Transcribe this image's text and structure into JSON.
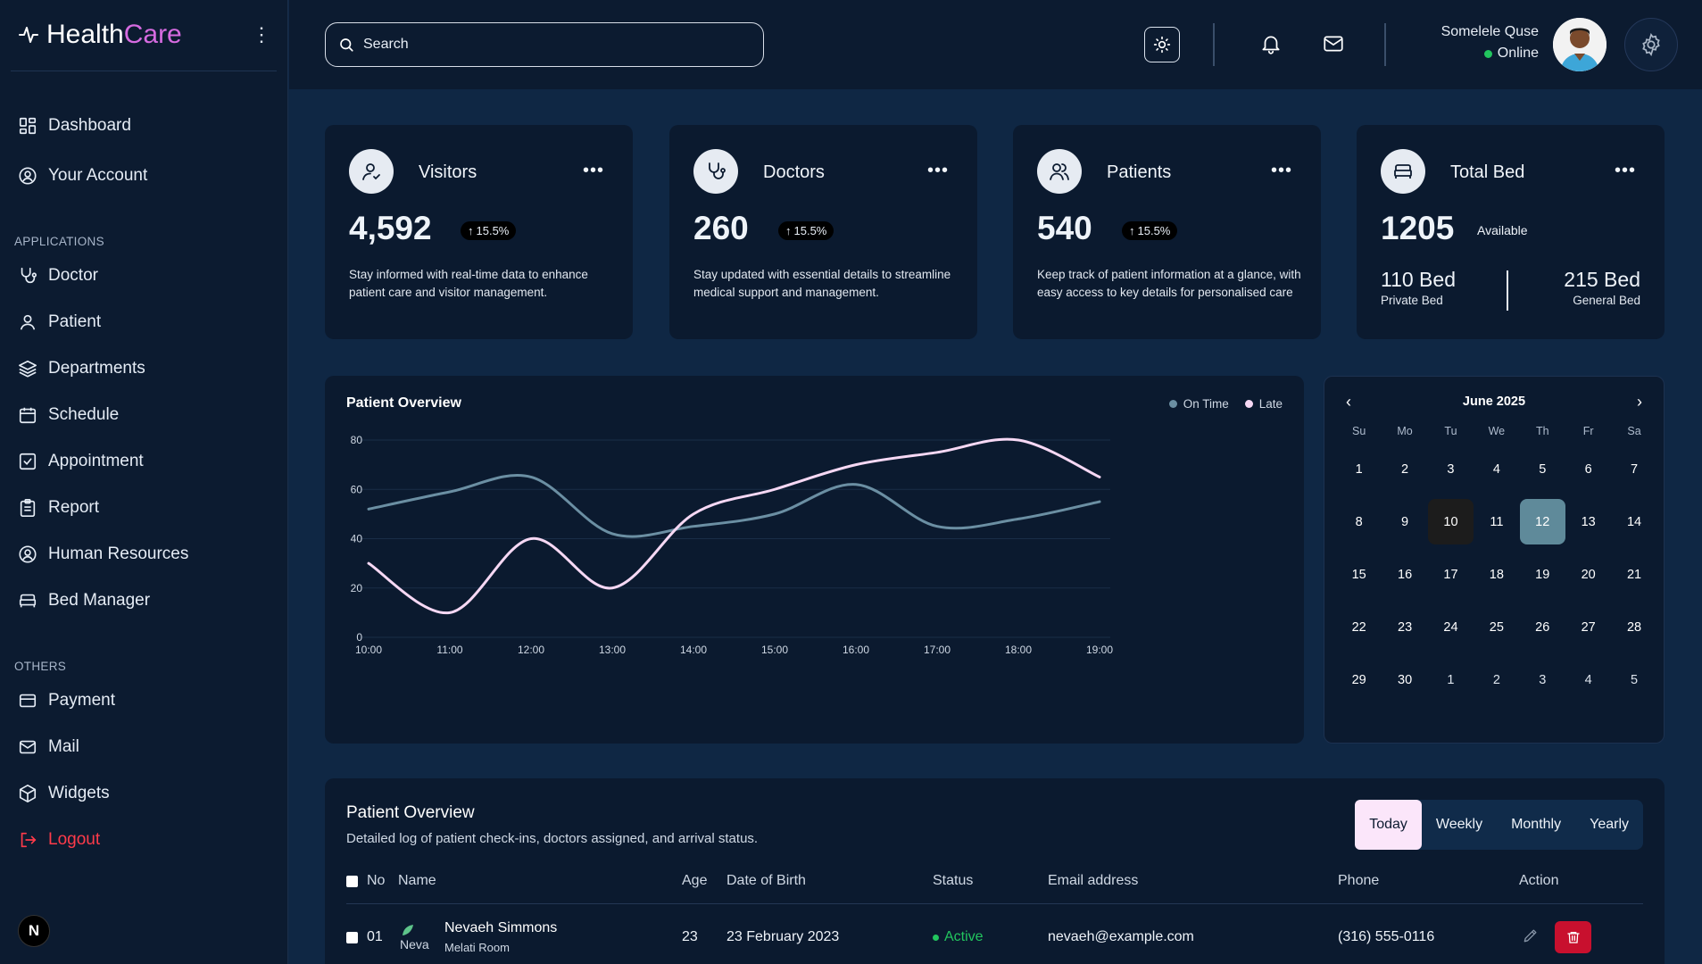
{
  "brand": {
    "name_part1": "Health",
    "name_part2": "Care",
    "accent_color": "#d66be0"
  },
  "sidebar": {
    "main_items": [
      {
        "label": "Dashboard",
        "icon": "dashboard-icon"
      },
      {
        "label": "Your Account",
        "icon": "user-circle-icon"
      }
    ],
    "applications_label": "APPLICATIONS",
    "applications": [
      {
        "label": "Doctor",
        "icon": "stethoscope-icon"
      },
      {
        "label": "Patient",
        "icon": "user-icon"
      },
      {
        "label": "Departments",
        "icon": "layers-icon"
      },
      {
        "label": "Schedule",
        "icon": "calendar-icon"
      },
      {
        "label": "Appointment",
        "icon": "checkbox-calendar-icon"
      },
      {
        "label": "Report",
        "icon": "report-icon"
      },
      {
        "label": "Human Resources",
        "icon": "user-circle-icon"
      },
      {
        "label": "Bed Manager",
        "icon": "bed-icon"
      }
    ],
    "others_label": "OTHERS",
    "others": [
      {
        "label": "Payment",
        "icon": "card-icon"
      },
      {
        "label": "Mail",
        "icon": "mail-icon"
      },
      {
        "label": "Widgets",
        "icon": "cube-icon"
      },
      {
        "label": "Logout",
        "icon": "logout-icon"
      }
    ],
    "badge": "N"
  },
  "topbar": {
    "search_placeholder": "Search",
    "user_name": "Somelele Quse",
    "user_status": "Online"
  },
  "cards": [
    {
      "title": "Visitors",
      "value": "4,592",
      "change": "15.5%",
      "description": "Stay informed with real-time data to enhance patient care and visitor management.",
      "icon": "visitor-icon"
    },
    {
      "title": "Doctors",
      "value": "260",
      "change": "15.5%",
      "description": "Stay updated with essential details to streamline medical support and management.",
      "icon": "stethoscope-icon"
    },
    {
      "title": "Patients",
      "value": "540",
      "change": "15.5%",
      "description": "Keep track of patient information at a glance, with easy access to key details for personalised care",
      "icon": "users-icon"
    },
    {
      "title": "Total Bed",
      "value": "1205",
      "available_label": "Available",
      "private_value": "110 Bed",
      "private_label": "Private Bed",
      "general_value": "215 Bed",
      "general_label": "General Bed",
      "icon": "bed-icon"
    }
  ],
  "chart_data": {
    "type": "line",
    "title": "Patient Overview",
    "x": [
      "10:00",
      "11:00",
      "12:00",
      "13:00",
      "14:00",
      "15:00",
      "16:00",
      "17:00",
      "18:00",
      "19:00"
    ],
    "ylim": [
      0,
      80
    ],
    "yticks": [
      0,
      20,
      40,
      60,
      80
    ],
    "series": [
      {
        "name": "On Time",
        "color": "#6b8fa3",
        "values": [
          52,
          59,
          65,
          42,
          45,
          50,
          62,
          45,
          48,
          55
        ]
      },
      {
        "name": "Late",
        "color": "#f6d8f4",
        "values": [
          30,
          10,
          40,
          20,
          50,
          60,
          70,
          75,
          80,
          65
        ]
      }
    ],
    "grid": true,
    "legend": "top-right"
  },
  "calendar": {
    "month": "June 2025",
    "weekdays": [
      "Su",
      "Mo",
      "Tu",
      "We",
      "Th",
      "Fr",
      "Sa"
    ],
    "weeks": [
      [
        "1",
        "2",
        "3",
        "4",
        "5",
        "6",
        "7"
      ],
      [
        "8",
        "9",
        "10",
        "11",
        "12",
        "13",
        "14"
      ],
      [
        "15",
        "16",
        "17",
        "18",
        "19",
        "20",
        "21"
      ],
      [
        "22",
        "23",
        "24",
        "25",
        "26",
        "27",
        "28"
      ],
      [
        "29",
        "30",
        "1",
        "2",
        "3",
        "4",
        "5"
      ]
    ],
    "today": "10",
    "selected": "12"
  },
  "patients": {
    "title": "Patient Overview",
    "subtitle": "Detailed log of patient check-ins, doctors assigned, and arrival status.",
    "tabs": [
      "Today",
      "Weekly",
      "Monthly",
      "Yearly"
    ],
    "active_tab": "Today",
    "headers": [
      "No",
      "Name",
      "Age",
      "Date of Birth",
      "Status",
      "Email address",
      "Phone",
      "Action"
    ],
    "rows": [
      {
        "no": "01",
        "avatar_alt": "Neva",
        "name": "Nevaeh Simmons",
        "room": "Melati Room",
        "age": "23",
        "dob": "23 February 2023",
        "status": "Active",
        "email": "nevaeh@example.com",
        "phone": "(316) 555-0116"
      }
    ]
  }
}
